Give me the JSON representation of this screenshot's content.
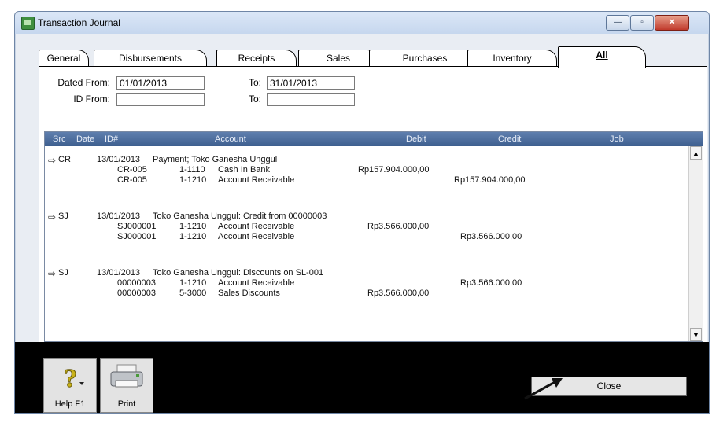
{
  "window": {
    "title": "Transaction Journal",
    "caption_min": "—",
    "caption_max": "▫",
    "caption_close": "✕"
  },
  "tabs": [
    {
      "label": "General"
    },
    {
      "label": "Disbursements"
    },
    {
      "label": "Receipts"
    },
    {
      "label": "Sales"
    },
    {
      "label": "Purchases"
    },
    {
      "label": "Inventory"
    },
    {
      "label": "All",
      "active": true
    }
  ],
  "filters": {
    "dated_from_label": "Dated From:",
    "dated_from_value": "01/01/2013",
    "dated_to_label": "To:",
    "dated_to_value": "31/01/2013",
    "id_from_label": "ID From:",
    "id_from_value": "",
    "id_to_label": "To:",
    "id_to_value": ""
  },
  "grid": {
    "headers": {
      "src": "Src",
      "date": "Date",
      "id": "ID#",
      "account": "Account",
      "debit": "Debit",
      "credit": "Credit",
      "job": "Job"
    },
    "entries": [
      {
        "src": "CR",
        "date": "13/01/2013",
        "memo": "Payment; Toko Ganesha Unggul",
        "lines": [
          {
            "id": "CR-005",
            "acct": "1-1110",
            "name": "Cash In Bank",
            "debit": "Rp157.904.000,00",
            "credit": ""
          },
          {
            "id": "CR-005",
            "acct": "1-1210",
            "name": "Account Receivable",
            "debit": "",
            "credit": "Rp157.904.000,00"
          }
        ]
      },
      {
        "src": "SJ",
        "date": "13/01/2013",
        "memo": "Toko Ganesha Unggul: Credit from 00000003",
        "lines": [
          {
            "id": "SJ000001",
            "acct": "1-1210",
            "name": "Account Receivable",
            "debit": "Rp3.566.000,00",
            "credit": ""
          },
          {
            "id": "SJ000001",
            "acct": "1-1210",
            "name": "Account Receivable",
            "debit": "",
            "credit": "Rp3.566.000,00"
          }
        ]
      },
      {
        "src": "SJ",
        "date": "13/01/2013",
        "memo": "Toko Ganesha Unggul: Discounts on SL-001",
        "lines": [
          {
            "id": "00000003",
            "acct": "1-1210",
            "name": "Account Receivable",
            "debit": "",
            "credit": "Rp3.566.000,00"
          },
          {
            "id": "00000003",
            "acct": "5-3000",
            "name": "Sales Discounts",
            "debit": "Rp3.566.000,00",
            "credit": ""
          }
        ]
      }
    ]
  },
  "toolbar": {
    "help_label": "Help F1",
    "print_label": "Print",
    "close_label": "Close"
  },
  "icons": {
    "src_arrow": "right-arrow-icon",
    "help": "help-icon",
    "print": "printer-icon"
  }
}
